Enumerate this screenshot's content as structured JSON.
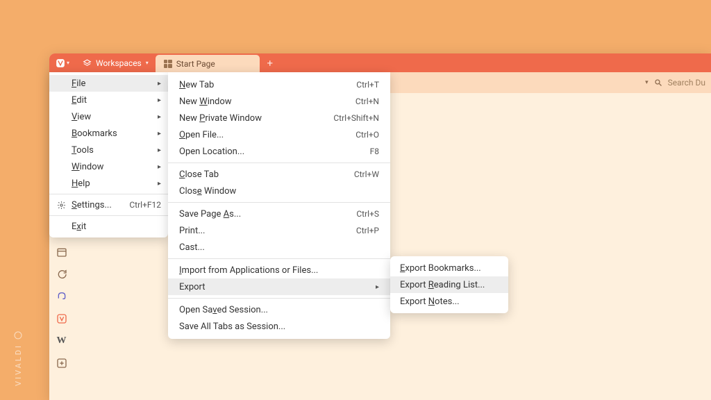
{
  "brand": "VIVALDI",
  "tab_bar": {
    "workspaces_label": "Workspaces",
    "tab_title": "Start Page"
  },
  "address_bar": {
    "search_placeholder": "Search Du"
  },
  "menu_level1": [
    {
      "label": "File",
      "underline": "F",
      "has_arrow": true,
      "highlight": true
    },
    {
      "label": "Edit",
      "underline": "E",
      "has_arrow": true
    },
    {
      "label": "View",
      "underline": "V",
      "has_arrow": true
    },
    {
      "label": "Bookmarks",
      "underline": "B",
      "has_arrow": true
    },
    {
      "label": "Tools",
      "underline": "T",
      "has_arrow": true
    },
    {
      "label": "Window",
      "underline": "W",
      "has_arrow": true
    },
    {
      "label": "Help",
      "underline": "H",
      "has_arrow": true
    },
    {
      "separator": true
    },
    {
      "label": "Settings...",
      "underline": "S",
      "icon": "gear",
      "shortcut": "Ctrl+F12"
    },
    {
      "separator": true
    },
    {
      "label": "Exit",
      "underline": "x"
    }
  ],
  "menu_level2": [
    {
      "label": "New Tab",
      "underline": "N",
      "shortcut": "Ctrl+T"
    },
    {
      "label": "New Window",
      "underline": "W",
      "shortcut": "Ctrl+N"
    },
    {
      "label": "New Private Window",
      "underline": "P",
      "shortcut": "Ctrl+Shift+N"
    },
    {
      "label": "Open File...",
      "underline": "O",
      "shortcut": "Ctrl+O"
    },
    {
      "label": "Open Location...",
      "shortcut": "F8"
    },
    {
      "separator": true
    },
    {
      "label": "Close Tab",
      "underline": "C",
      "shortcut": "Ctrl+W"
    },
    {
      "label": "Close Window",
      "underline": "e"
    },
    {
      "separator": true
    },
    {
      "label": "Save Page As...",
      "underline": "A",
      "shortcut": "Ctrl+S"
    },
    {
      "label": "Print...",
      "shortcut": "Ctrl+P"
    },
    {
      "label": "Cast..."
    },
    {
      "separator": true
    },
    {
      "label": "Import from Applications or Files...",
      "underline": "I"
    },
    {
      "label": "Export",
      "has_arrow": true,
      "highlight": true
    },
    {
      "separator": true
    },
    {
      "label": "Open Saved Session...",
      "underline": "v"
    },
    {
      "label": "Save All Tabs as Session..."
    }
  ],
  "menu_level3": [
    {
      "label": "Export Bookmarks...",
      "underline": "E"
    },
    {
      "label": "Export Reading List...",
      "underline": "R",
      "highlight": true
    },
    {
      "label": "Export Notes...",
      "underline": "N"
    }
  ]
}
